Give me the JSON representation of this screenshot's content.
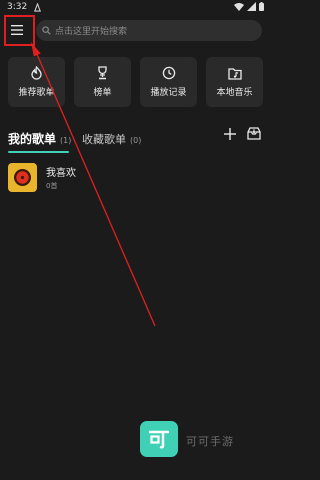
{
  "status_bar": {
    "time": "3:32",
    "icons": [
      "notification-icon",
      "wifi-icon",
      "signal-icon",
      "battery-icon"
    ]
  },
  "header": {
    "menu_icon": "menu-icon",
    "search_placeholder": "点击这里开始搜索"
  },
  "quick_tiles": [
    {
      "label": "推荐歌单",
      "icon": "recommend-icon"
    },
    {
      "label": "榜单",
      "icon": "trophy-icon"
    },
    {
      "label": "播放记录",
      "icon": "clock-icon"
    },
    {
      "label": "本地音乐",
      "icon": "folder-music-icon"
    }
  ],
  "tabs": {
    "mine_label": "我的歌单",
    "mine_count": "(1)",
    "fav_label": "收藏歌单",
    "fav_count": "(0)"
  },
  "playlists": [
    {
      "title": "我喜欢",
      "subtitle": "0首"
    }
  ],
  "watermark": {
    "text": "可可手游"
  },
  "colors": {
    "background": "#1b1b1b",
    "accent": "#3fd0b6",
    "annotation": "#e02020",
    "cover": "#e8b52c"
  }
}
